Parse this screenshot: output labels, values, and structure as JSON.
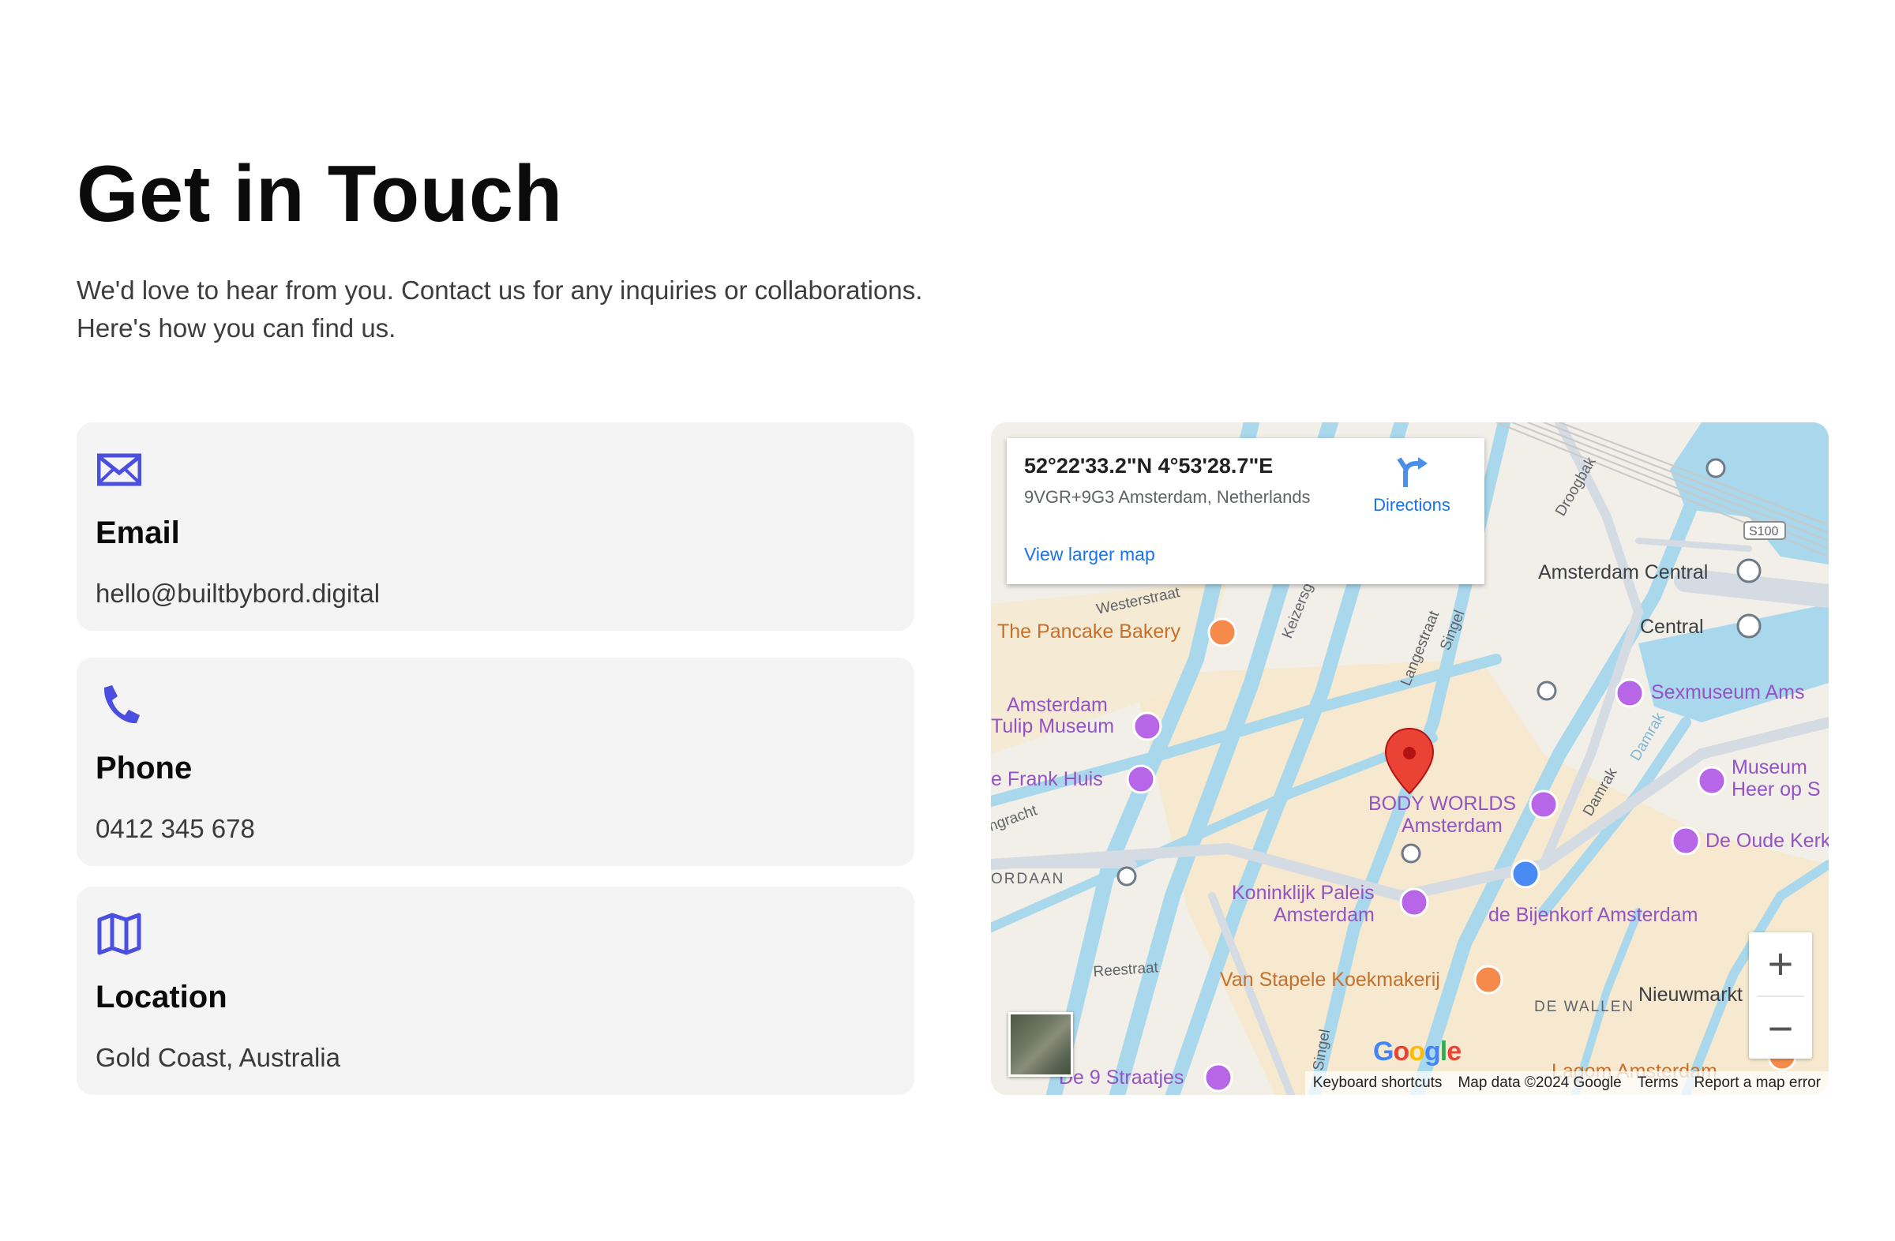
{
  "page": {
    "title": "Get in Touch",
    "intro_line1": "We'd love to hear from you. Contact us for any inquiries or collaborations.",
    "intro_line2": "Here's how you can find us."
  },
  "contact": {
    "accent_color": "#4b4fe0",
    "email": {
      "icon": "envelope-icon",
      "title": "Email",
      "value": "hello@builtbybord.digital"
    },
    "phone": {
      "icon": "phone-icon",
      "title": "Phone",
      "value": "0412 345 678"
    },
    "location": {
      "icon": "map-icon",
      "title": "Location",
      "value": "Gold Coast, Australia"
    }
  },
  "map": {
    "infobox": {
      "coordinates": "52°22'33.2\"N 4°53'28.7\"E",
      "address": "9VGR+9G3 Amsterdam, Netherlands",
      "directions_label": "Directions",
      "larger_map_label": "View larger map"
    },
    "places": {
      "pancake": "The Pancake Bakery",
      "tulip_1": "Amsterdam",
      "tulip_2": "Tulip Museum",
      "frank": "e Frank Huis",
      "bodyworlds_1": "BODY WORLDS",
      "bodyworlds_2": "Amsterdam",
      "paleis_1": "Koninklijk Paleis",
      "paleis_2": "Amsterdam",
      "koekmakerij": "Van Stapele Koekmakerij",
      "bijenkorf": "de Bijenkorf Amsterdam",
      "sexmuseum": "Sexmuseum Ams",
      "museum_1": "Museum",
      "museum_2": "Heer op S",
      "oude_kerk": "De Oude Kerk",
      "central": "Amsterdam Central",
      "central_metro": "Central",
      "nieuwmarkt": "Nieuwmarkt",
      "de_wallen": "DE WALLEN",
      "jordaan": "ORDAAN",
      "negen_straatjes": "De 9 Straatjes",
      "lagom": "Lagom Amsterdam"
    },
    "streets": {
      "westerstraat": "Westerstraat",
      "keizersgracht": "Keizersgr",
      "langestraat": "Langestraat",
      "singel": "Singel",
      "singel2": "Singel",
      "droogbak": "Droogbak",
      "damrak": "Damrak",
      "damrak2": "Damrak",
      "reestraat": "Reestraat",
      "gracht": "ngracht",
      "s100": "S100"
    },
    "controls": {
      "zoom_in": "+",
      "zoom_out": "−"
    },
    "google_logo": {
      "letters": [
        "G",
        "o",
        "o",
        "g",
        "l",
        "e"
      ],
      "colors": [
        "#4285F4",
        "#EA4335",
        "#FBBC05",
        "#4285F4",
        "#34A853",
        "#EA4335"
      ]
    },
    "attribution": {
      "shortcuts": "Keyboard shortcuts",
      "data": "Map data ©2024 Google",
      "terms": "Terms",
      "report": "Report a map error"
    }
  }
}
